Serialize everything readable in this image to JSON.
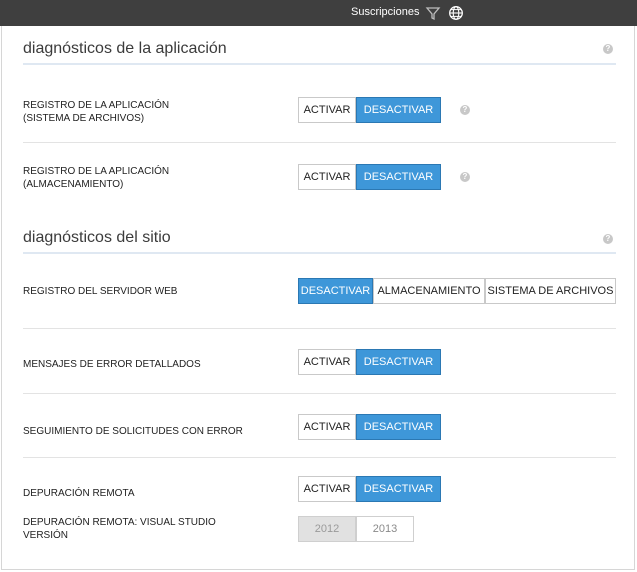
{
  "topbar": {
    "subscriptions_label": "Suscripciones",
    "icons": [
      "filter-icon",
      "globe-icon"
    ]
  },
  "app_diag": {
    "title": "diagnósticos de la aplicación",
    "rows": [
      {
        "label_line1": "REGISTRO DE LA APLICACIÓN",
        "label_line2": "(SISTEMA DE ARCHIVOS)",
        "on_label": "ACTIVAR",
        "off_label": "DESACTIVAR",
        "selected": "DESACTIVAR"
      },
      {
        "label_line1": "REGISTRO DE LA APLICACIÓN",
        "label_line2": "(ALMACENAMIENTO)",
        "on_label": "ACTIVAR",
        "off_label": "DESACTIVAR",
        "selected": "DESACTIVAR"
      }
    ]
  },
  "site_diag": {
    "title": "diagnósticos del sitio",
    "web_server_log": {
      "label": "REGISTRO DEL SERVIDOR WEB",
      "options": [
        "DESACTIVAR",
        "ALMACENAMIENTO",
        "SISTEMA DE ARCHIVOS"
      ],
      "selected": "DESACTIVAR"
    },
    "detailed_errors": {
      "label": "MENSAJES DE ERROR DETALLADOS",
      "on_label": "ACTIVAR",
      "off_label": "DESACTIVAR",
      "selected": "DESACTIVAR"
    },
    "failed_requests": {
      "label": "SEGUIMIENTO DE SOLICITUDES CON ERROR",
      "on_label": "ACTIVAR",
      "off_label": "DESACTIVAR",
      "selected": "DESACTIVAR"
    },
    "remote_debug": {
      "label": "DEPURACIÓN REMOTA",
      "on_label": "ACTIVAR",
      "off_label": "DESACTIVAR",
      "selected": "DESACTIVAR"
    },
    "vs_version": {
      "label_line1": "DEPURACIÓN REMOTA: VISUAL STUDIO",
      "label_line2": "VERSIÓN",
      "options": [
        "2012",
        "2013"
      ],
      "selected": "2012"
    }
  },
  "help_glyph": "?",
  "colors": {
    "accent": "#3e97d9",
    "topbar": "#3f3f3f",
    "section_rule": "#dfe8f2"
  }
}
